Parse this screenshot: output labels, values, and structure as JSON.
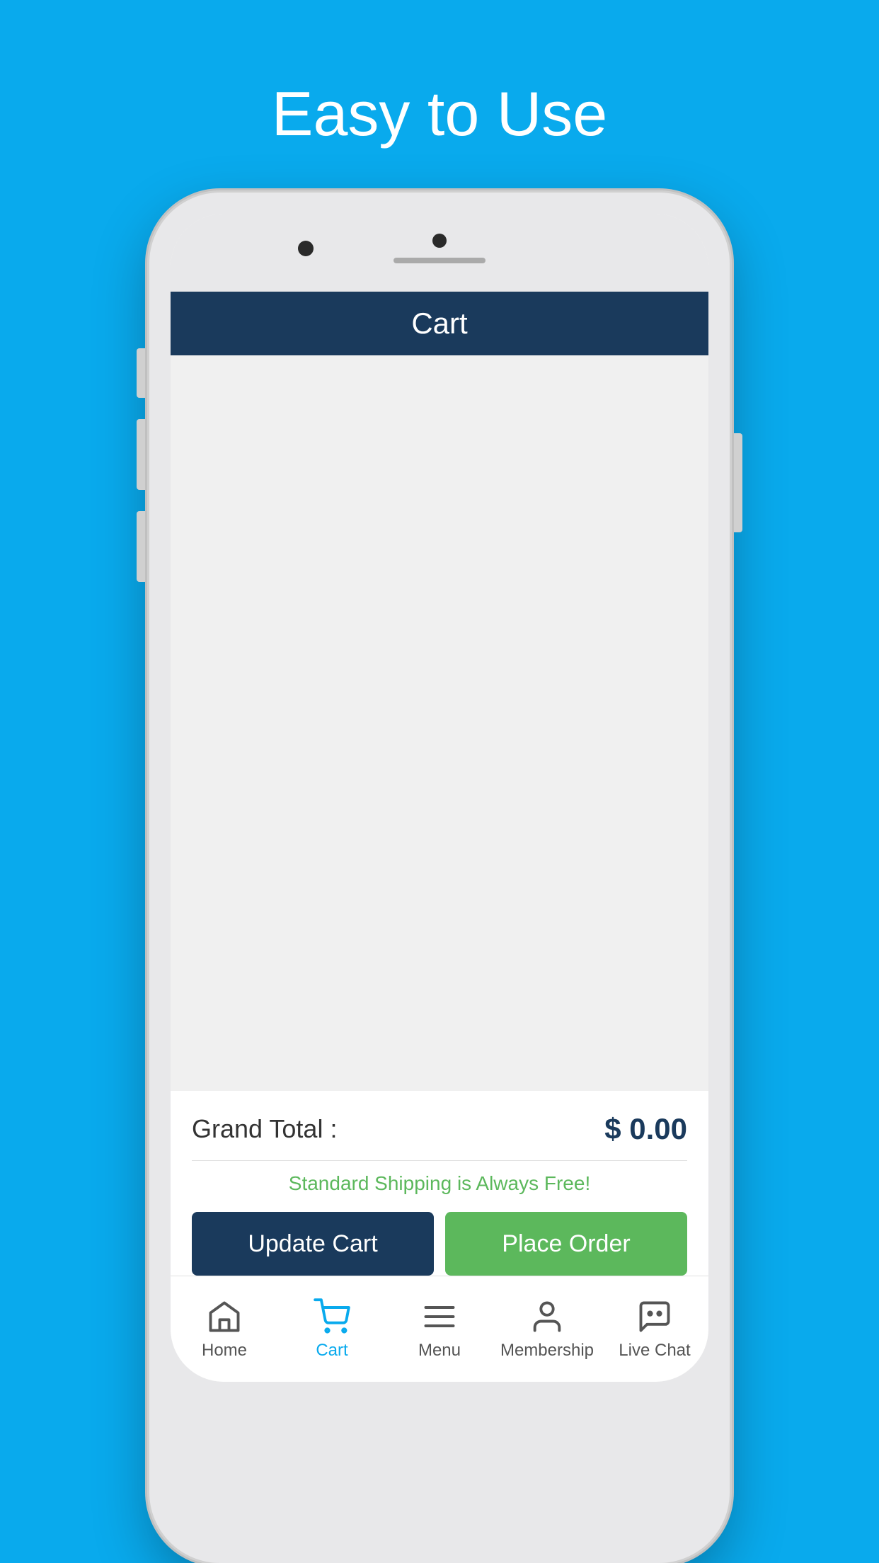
{
  "page": {
    "title": "Easy to Use",
    "background_color": "#09AAED"
  },
  "app_header": {
    "title": "Cart"
  },
  "cart": {
    "grand_total_label": "Grand Total :",
    "grand_total_amount": "$ 0.00",
    "shipping_notice": "Standard Shipping is Always Free!",
    "update_cart_label": "Update Cart",
    "place_order_label": "Place Order"
  },
  "bottom_nav": {
    "items": [
      {
        "id": "home",
        "label": "Home",
        "active": false
      },
      {
        "id": "cart",
        "label": "Cart",
        "active": true
      },
      {
        "id": "menu",
        "label": "Menu",
        "active": false
      },
      {
        "id": "membership",
        "label": "Membership",
        "active": false
      },
      {
        "id": "live-chat",
        "label": "Live Chat",
        "active": false
      }
    ]
  }
}
